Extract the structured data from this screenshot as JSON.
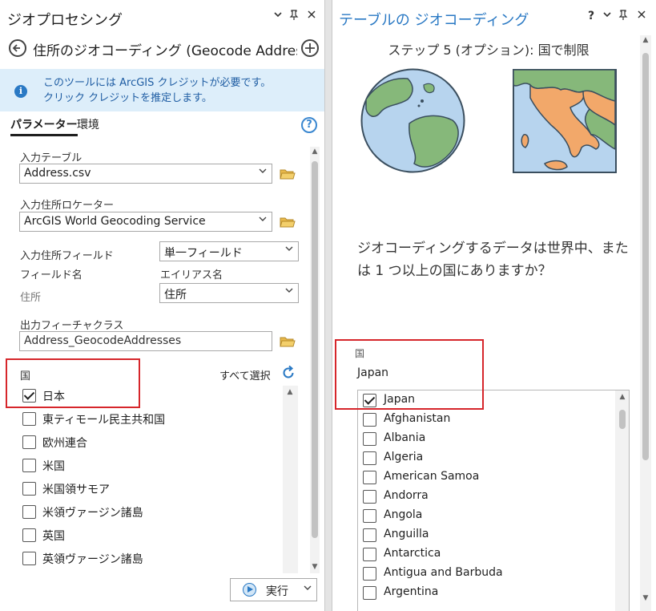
{
  "left_pane": {
    "title": "ジオプロセシング",
    "header_icons": [
      "chevron-down-icon",
      "pin-icon",
      "close-icon"
    ],
    "tool_name": "住所のジオコーディング (Geocode Addres...",
    "info_banner": {
      "line1": "このツールには ArcGIS クレジットが必要です。",
      "line2": "クリック クレジットを推定します。"
    },
    "tabs": [
      {
        "label": "パラメーター",
        "active": true
      },
      {
        "label": "環境",
        "active": false
      }
    ],
    "input_table": {
      "label": "入力テーブル",
      "value": "Address.csv"
    },
    "locator": {
      "label": "入力住所ロケーター",
      "value": "ArcGIS World Geocoding Service"
    },
    "address_fields": {
      "label": "入力住所フィールド",
      "value": "単一フィールド"
    },
    "field_table": {
      "col1": "フィールド名",
      "col2": "エイリアス名",
      "row_name": "住所",
      "row_alias": "住所"
    },
    "output": {
      "label": "出力フィーチャクラス",
      "value": "Address_GeocodeAddresses"
    },
    "country": {
      "label": "国",
      "select_all": "すべて選択",
      "items": [
        {
          "label": "日本",
          "checked": true
        },
        {
          "label": "東ティモール民主共和国",
          "checked": false
        },
        {
          "label": "欧州連合",
          "checked": false
        },
        {
          "label": "米国",
          "checked": false
        },
        {
          "label": "米国領サモア",
          "checked": false
        },
        {
          "label": "米領ヴァージン諸島",
          "checked": false
        },
        {
          "label": "英国",
          "checked": false
        },
        {
          "label": "英領ヴァージン諸島",
          "checked": false
        }
      ]
    },
    "run_button": "実行"
  },
  "right_pane": {
    "title": "テーブルの ジオコーディング",
    "header_icons": [
      "help-icon",
      "chevron-down-icon",
      "pin-icon",
      "close-icon"
    ],
    "header_help": "?",
    "step_title": "ステップ 5 (オプション): 国で制限",
    "question": "ジオコーディングするデータは世界中、または 1 つ以上の国にありますか？",
    "country_label": "国",
    "country_value": "Japan",
    "countries": [
      {
        "label": "Japan",
        "checked": true
      },
      {
        "label": "Afghanistan",
        "checked": false
      },
      {
        "label": "Albania",
        "checked": false
      },
      {
        "label": "Algeria",
        "checked": false
      },
      {
        "label": "American Samoa",
        "checked": false
      },
      {
        "label": "Andorra",
        "checked": false
      },
      {
        "label": "Angola",
        "checked": false
      },
      {
        "label": "Anguilla",
        "checked": false
      },
      {
        "label": "Antarctica",
        "checked": false
      },
      {
        "label": "Antigua and Barbuda",
        "checked": false
      },
      {
        "label": "Argentina",
        "checked": false
      }
    ]
  },
  "colors": {
    "accent_blue": "#2a79c4",
    "highlight_red": "#d6262b",
    "banner_bg": "#ddeefa",
    "folder_yellow": "#e8b84a"
  }
}
